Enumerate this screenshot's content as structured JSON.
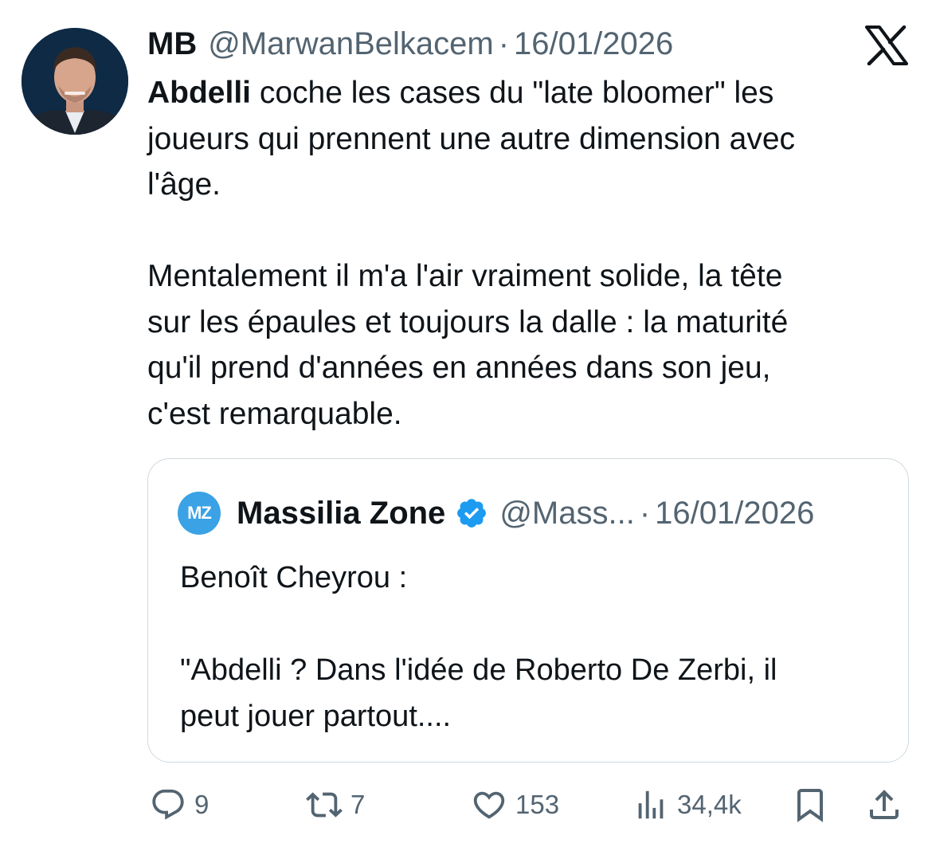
{
  "tweet": {
    "author_name": "MB",
    "author_handle": "@MarwanBelkacem",
    "separator": "·",
    "date": "16/01/2026",
    "text_bold": "Abdelli",
    "text_line1_rest": " coche les cases du \"late bloomer\" les",
    "text_line2": "joueurs qui prennent une autre dimension avec",
    "text_line3": "l'âge.",
    "text_para2_line1": "Mentalement il m'a l'air vraiment solide, la tête",
    "text_para2_line2": "sur les épaules et toujours la dalle : la maturité",
    "text_para2_line3": "qu'il prend d'années en années dans son jeu,",
    "text_para2_line4": "c'est remarquable."
  },
  "quote": {
    "logo_text": "MZ",
    "author_name": "Massilia Zone",
    "author_handle": "@Mass...",
    "separator": "·",
    "date": "16/01/2026",
    "line1": "Benoît Cheyrou :",
    "line2": "\"Abdelli ? Dans l'idée de Roberto De Zerbi, il",
    "line3": "peut jouer partout...."
  },
  "actions": {
    "replies": "9",
    "reposts": "7",
    "likes": "153",
    "views": "34,4k"
  },
  "icons": {
    "brand": "x-logo",
    "verified": "verified-badge-icon",
    "reply": "reply-icon",
    "repost": "repost-icon",
    "like": "heart-icon",
    "views": "views-icon",
    "bookmark": "bookmark-icon",
    "share": "share-icon"
  },
  "colors": {
    "text": "#0f1419",
    "secondary": "#536471",
    "verified": "#1d9bf0",
    "border": "#cfd9de"
  }
}
